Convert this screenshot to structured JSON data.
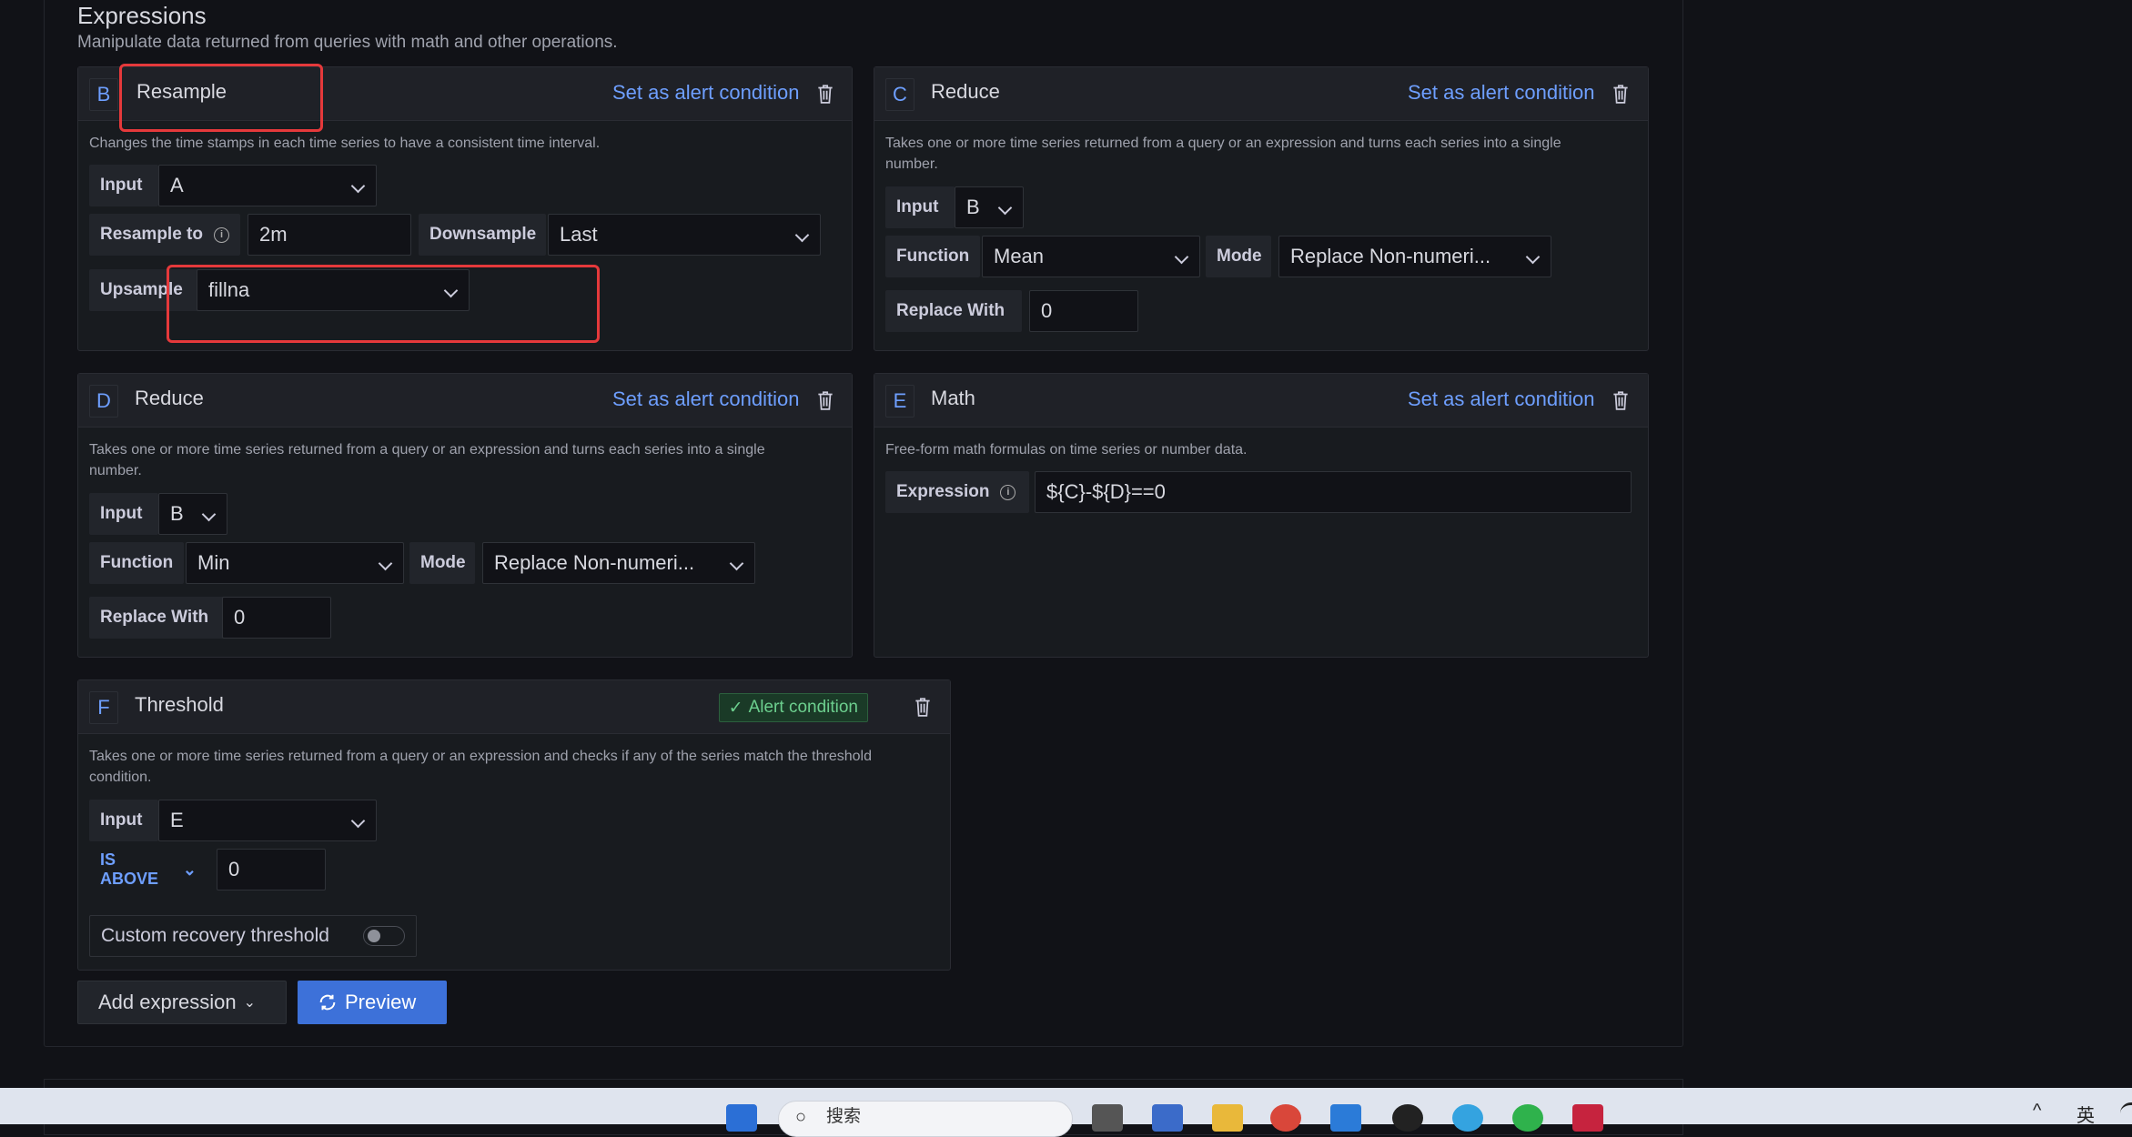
{
  "section": {
    "title": "Expressions",
    "description": "Manipulate data returned from queries with math and other operations."
  },
  "colors": {
    "accent": "#6e9fff",
    "primary_button": "#3d71d9",
    "highlight": "#e5393b",
    "alert_green": "#6ccf8e"
  },
  "cards": {
    "b": {
      "ref": "B",
      "name": "Resample",
      "alert_link": "Set as alert condition",
      "description": "Changes the time stamps in each time series to have a consistent time interval.",
      "input_label": "Input",
      "input_value": "A",
      "resample_label": "Resample to",
      "resample_value": "2m",
      "downsample_label": "Downsample",
      "downsample_value": "Last",
      "upsample_label": "Upsample",
      "upsample_value": "fillna"
    },
    "c": {
      "ref": "C",
      "name": "Reduce",
      "alert_link": "Set as alert condition",
      "description_line1": "Takes one or more time series returned from a query or an expression and turns each series into a single",
      "description_line2": "number.",
      "input_label": "Input",
      "input_value": "B",
      "function_label": "Function",
      "function_value": "Mean",
      "mode_label": "Mode",
      "mode_value": "Replace Non-numeri...",
      "replace_label": "Replace With",
      "replace_value": "0"
    },
    "d": {
      "ref": "D",
      "name": "Reduce",
      "alert_link": "Set as alert condition",
      "description_line1": "Takes one or more time series returned from a query or an expression and turns each series into a single",
      "description_line2": "number.",
      "input_label": "Input",
      "input_value": "B",
      "function_label": "Function",
      "function_value": "Min",
      "mode_label": "Mode",
      "mode_value": "Replace Non-numeri...",
      "replace_label": "Replace With",
      "replace_value": "0"
    },
    "e": {
      "ref": "E",
      "name": "Math",
      "alert_link": "Set as alert condition",
      "description": "Free-form math formulas on time series or number data.",
      "expression_label": "Expression",
      "expression_value": "${C}-${D}==0"
    },
    "f": {
      "ref": "F",
      "name": "Threshold",
      "alert_badge": "Alert condition",
      "description_line1": "Takes one or more time series returned from a query or an expression and checks if any of the series match the threshold",
      "description_line2": "condition.",
      "input_label": "Input",
      "input_value": "E",
      "operator": "IS ABOVE",
      "threshold_value": "0",
      "recovery_label": "Custom recovery threshold",
      "recovery_enabled": false
    }
  },
  "buttons": {
    "add_expression": "Add expression",
    "preview": "Preview"
  },
  "taskbar": {
    "search_placeholder": "搜索",
    "ime": "英"
  }
}
